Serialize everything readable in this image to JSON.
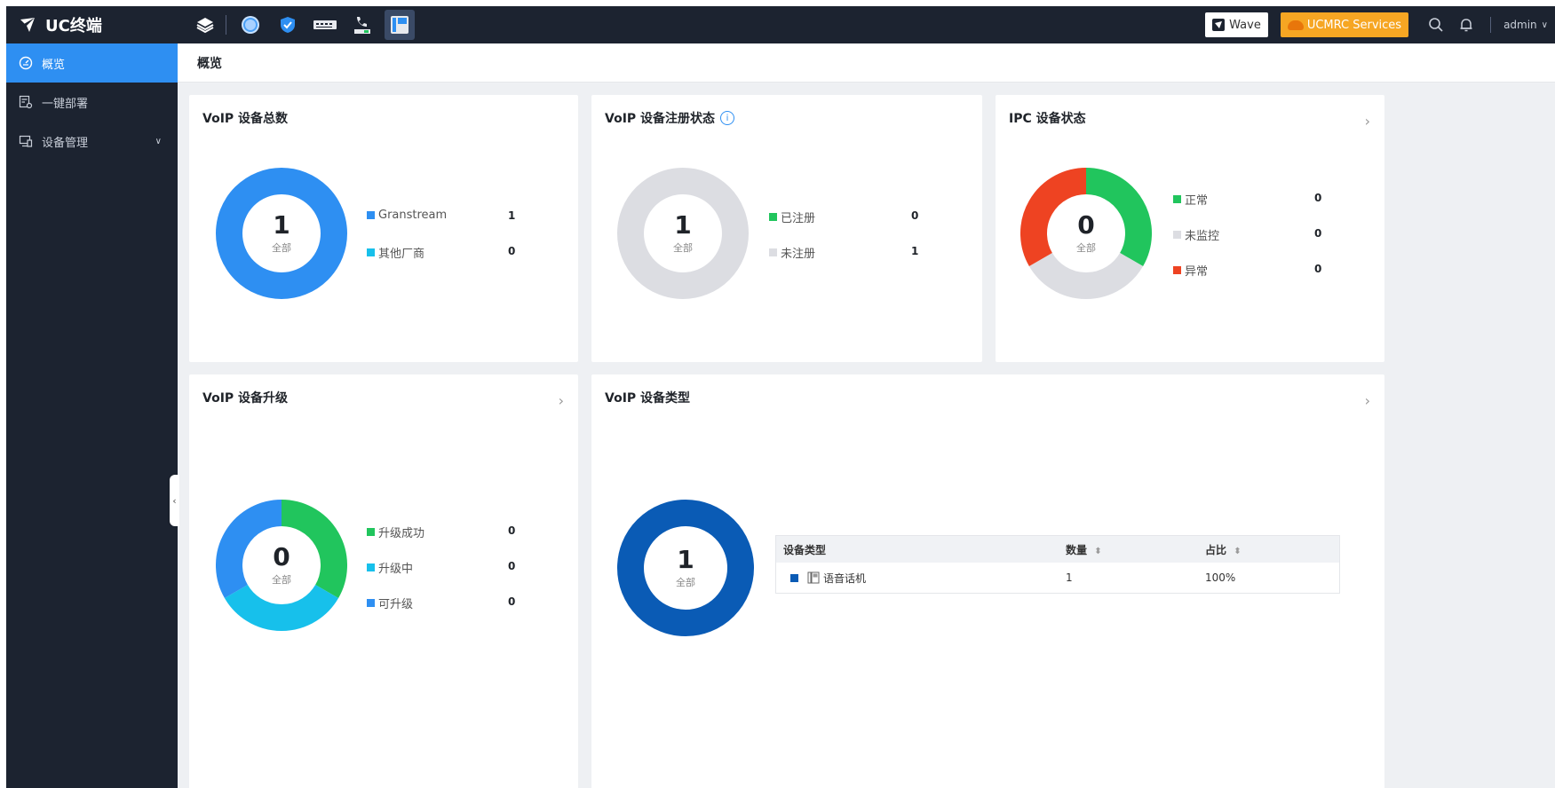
{
  "app": {
    "title": "UC终端"
  },
  "topbar": {
    "icons": [
      {
        "name": "layers-icon"
      },
      {
        "name": "globe-icon"
      },
      {
        "name": "shield-icon"
      },
      {
        "name": "switch-device-icon"
      },
      {
        "name": "phone-network-icon"
      },
      {
        "name": "desk-phone-icon",
        "active": true
      }
    ],
    "wave_label": "Wave",
    "ucm_label": "UCMRC Services",
    "user": "admin"
  },
  "sidebar": {
    "items": [
      {
        "label": "概览",
        "icon": "dashboard-icon",
        "active": true
      },
      {
        "label": "一键部署",
        "icon": "deploy-icon"
      },
      {
        "label": "设备管理",
        "icon": "device-manage-icon",
        "expandable": true
      }
    ]
  },
  "page": {
    "title": "概览"
  },
  "cards": {
    "voip_total": {
      "title": "VoIP 设备总数",
      "total": "1",
      "total_label": "全部",
      "legend": [
        {
          "label": "Granstream",
          "value": "1",
          "color": "#2e8ff2"
        },
        {
          "label": "其他厂商",
          "value": "0",
          "color": "#17c0eb"
        }
      ]
    },
    "voip_reg": {
      "title": "VoIP 设备注册状态",
      "total": "1",
      "total_label": "全部",
      "legend": [
        {
          "label": "已注册",
          "value": "0",
          "color": "#21c55d"
        },
        {
          "label": "未注册",
          "value": "1",
          "color": "#dcdde2"
        }
      ]
    },
    "ipc_status": {
      "title": "IPC 设备状态",
      "total": "0",
      "total_label": "全部",
      "legend": [
        {
          "label": "正常",
          "value": "0",
          "color": "#21c55d"
        },
        {
          "label": "未监控",
          "value": "0",
          "color": "#dcdde2"
        },
        {
          "label": "异常",
          "value": "0",
          "color": "#ee4322"
        }
      ]
    },
    "voip_upgrade": {
      "title": "VoIP 设备升级",
      "total": "0",
      "total_label": "全部",
      "legend": [
        {
          "label": "升级成功",
          "value": "0",
          "color": "#21c55d"
        },
        {
          "label": "升级中",
          "value": "0",
          "color": "#17c0eb"
        },
        {
          "label": "可升级",
          "value": "0",
          "color": "#2e8ff2"
        }
      ]
    },
    "voip_type": {
      "title": "VoIP 设备类型",
      "total": "1",
      "total_label": "全部",
      "table": {
        "headers": [
          "设备类型",
          "数量",
          "占比"
        ],
        "rows": [
          {
            "type": "语音话机",
            "count": "1",
            "ratio": "100%",
            "color": "#0a5bb5"
          }
        ]
      }
    }
  },
  "chart_data": [
    {
      "type": "pie",
      "title": "VoIP 设备总数",
      "categories": [
        "Granstream",
        "其他厂商"
      ],
      "values": [
        1,
        0
      ]
    },
    {
      "type": "pie",
      "title": "VoIP 设备注册状态",
      "categories": [
        "已注册",
        "未注册"
      ],
      "values": [
        0,
        1
      ]
    },
    {
      "type": "pie",
      "title": "IPC 设备状态",
      "categories": [
        "正常",
        "未监控",
        "异常"
      ],
      "values": [
        0,
        0,
        0
      ]
    },
    {
      "type": "pie",
      "title": "VoIP 设备升级",
      "categories": [
        "升级成功",
        "升级中",
        "可升级"
      ],
      "values": [
        0,
        0,
        0
      ]
    },
    {
      "type": "pie",
      "title": "VoIP 设备类型",
      "categories": [
        "语音话机"
      ],
      "values": [
        1
      ]
    }
  ]
}
